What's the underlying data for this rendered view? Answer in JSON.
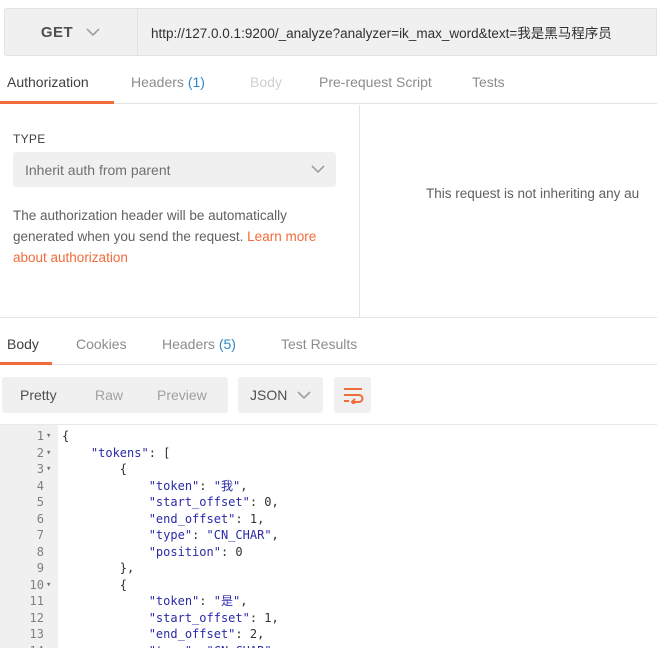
{
  "request": {
    "method": "GET",
    "url": "http://127.0.0.1:9200/_analyze?analyzer=ik_max_word&text=我是黑马程序员"
  },
  "request_tabs": [
    {
      "label": "Authorization",
      "count": "",
      "state": "active"
    },
    {
      "label": "Headers",
      "count": "(1)",
      "state": "normal"
    },
    {
      "label": "Body",
      "count": "",
      "state": "disabled"
    },
    {
      "label": "Pre-request Script",
      "count": "",
      "state": "normal"
    },
    {
      "label": "Tests",
      "count": "",
      "state": "normal"
    }
  ],
  "auth": {
    "type_label": "TYPE",
    "selected": "Inherit auth from parent",
    "desc_text": "The authorization header will be automatically generated when you send the request. ",
    "link_text": "Learn more about authorization",
    "right_message": "This request is not inheriting any au"
  },
  "response_tabs": [
    {
      "label": "Body",
      "count": "",
      "state": "active"
    },
    {
      "label": "Cookies",
      "count": "",
      "state": "normal"
    },
    {
      "label": "Headers",
      "count": "(5)",
      "state": "normal"
    },
    {
      "label": "Test Results",
      "count": "",
      "state": "normal"
    }
  ],
  "view_modes": [
    "Pretty",
    "Raw",
    "Preview"
  ],
  "active_view": "Pretty",
  "format": "JSON",
  "code_lines": [
    {
      "n": "1",
      "fold": true,
      "text": "{"
    },
    {
      "n": "2",
      "fold": true,
      "text": "    \"tokens\": ["
    },
    {
      "n": "3",
      "fold": true,
      "text": "        {"
    },
    {
      "n": "4",
      "fold": false,
      "text": "            \"token\": \"我\","
    },
    {
      "n": "5",
      "fold": false,
      "text": "            \"start_offset\": 0,"
    },
    {
      "n": "6",
      "fold": false,
      "text": "            \"end_offset\": 1,"
    },
    {
      "n": "7",
      "fold": false,
      "text": "            \"type\": \"CN_CHAR\","
    },
    {
      "n": "8",
      "fold": false,
      "text": "            \"position\": 0"
    },
    {
      "n": "9",
      "fold": false,
      "text": "        },"
    },
    {
      "n": "10",
      "fold": true,
      "text": "        {"
    },
    {
      "n": "11",
      "fold": false,
      "text": "            \"token\": \"是\","
    },
    {
      "n": "12",
      "fold": false,
      "text": "            \"start_offset\": 1,"
    },
    {
      "n": "13",
      "fold": false,
      "text": "            \"end_offset\": 2,"
    },
    {
      "n": "14",
      "fold": false,
      "text": "            \"type\": \"CN_CHAR\""
    }
  ],
  "colors": {
    "accent": "#f26b3a",
    "count_blue": "#2f88c7",
    "json_blue": "#2a2aa8"
  },
  "icons": {
    "method_dropdown": "chevron-down-icon",
    "auth_dropdown": "chevron-down-icon",
    "format_dropdown": "chevron-down-icon",
    "wrap": "wrap-lines-icon"
  }
}
